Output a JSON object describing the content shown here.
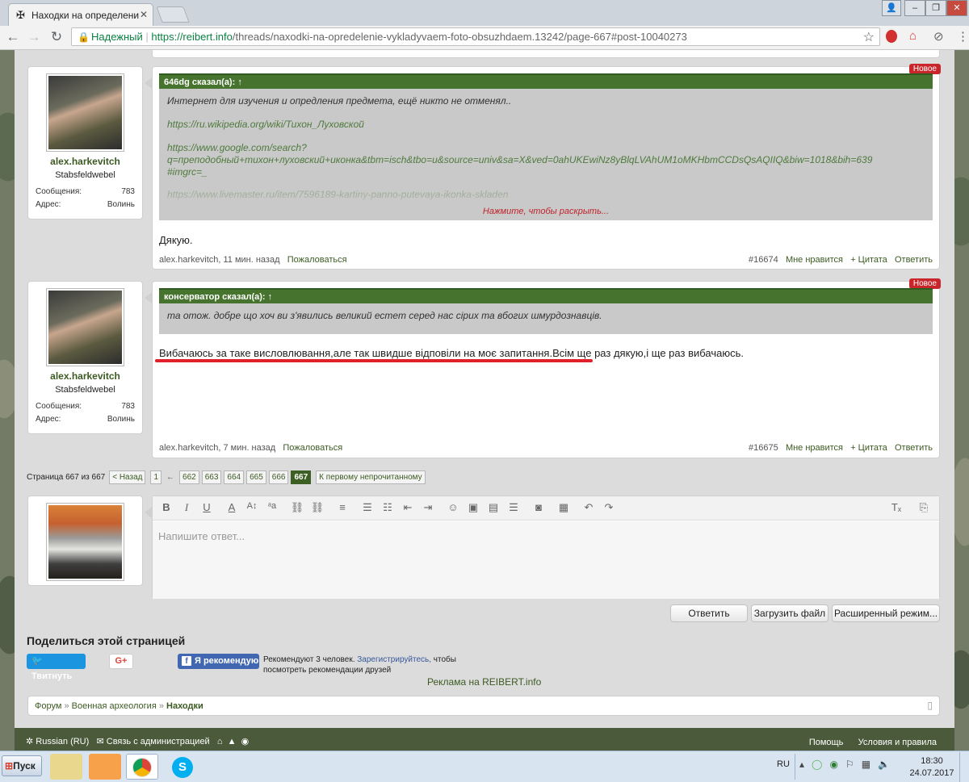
{
  "browser": {
    "tab_title": "Находки на определени",
    "secure_label": "Надежный",
    "url_host": "https://reibert.info",
    "url_path": "/threads/naxodki-na-opredelenie-vykladyvaem-foto-obsuzhdaem.13242/page-667#post-10040273"
  },
  "posts": [
    {
      "author": "alex.harkevitch",
      "rank": "Stabsfeldwebel",
      "stats": [
        {
          "label": "Сообщения:",
          "value": "783"
        },
        {
          "label": "Адрес:",
          "value": "Волинь"
        }
      ],
      "badge": "Новое",
      "quote_head": "646dg сказал(а): ↑",
      "quote_lines": [
        "Интернет для изучения и опредления предмета, ещё никто не отменял..",
        "https://ru.wikipedia.org/wiki/Тихон_Луховской",
        "https://www.google.com/search?",
        "q=преподобный+тихон+луховский+иконка&tbm=isch&tbo=u&source=univ&sa=X&ved=0ahUKEwiNz8yBlqLVAhUM1oMKHbmCCDsQsAQIIQ&biw=1018&bih=639",
        "#imgrc=_",
        "https://www.livemaster.ru/item/7596189-kartiny-panno-putevaya-ikonka-skladen"
      ],
      "expand": "Нажмите, чтобы раскрыть...",
      "body": "Дякую.",
      "meta_author": "alex.harkevitch",
      "meta_time": ", 11 мин. назад",
      "report": "Пожаловаться",
      "num": "#16674",
      "like": "Мне нравится",
      "quote": "+ Цитата",
      "reply": "Ответить"
    },
    {
      "author": "alex.harkevitch",
      "rank": "Stabsfeldwebel",
      "stats": [
        {
          "label": "Сообщения:",
          "value": "783"
        },
        {
          "label": "Адрес:",
          "value": "Волинь"
        }
      ],
      "badge": "Новое",
      "quote_head": "консерватор сказал(а): ↑",
      "quote_lines": [
        "та отож. добре що хоч ви з'явились великий естет серед нас сірих та вбогих шмурдознавців."
      ],
      "body_a": "Вибачаюсь за таке висловлювання,але так швидше відповіли на моє запитання.",
      "body_b": "Всім ще раз дякую,і ще раз вибачаюсь.",
      "meta_author": "alex.harkevitch",
      "meta_time": ", 7 мин. назад",
      "report": "Пожаловаться",
      "num": "#16675",
      "like": "Мне нравится",
      "quote": "+ Цитата",
      "reply": "Ответить"
    }
  ],
  "pagination": {
    "label": "Страница 667 из 667",
    "prev": "< Назад",
    "first": "1",
    "ellipsis": "←",
    "pages": [
      "662",
      "663",
      "664",
      "665",
      "666",
      "667"
    ],
    "unread": "К первому непрочитанному"
  },
  "editor": {
    "placeholder": "Напишите ответ...",
    "reply_btn": "Ответить",
    "upload_btn": "Загрузить файл",
    "advanced_btn": "Расширенный режим..."
  },
  "share": {
    "title": "Поделиться этой страницей",
    "tweet": "Твитнуть",
    "gplus": "G+",
    "fb": "Я рекомендую",
    "fb_text1": "Рекомендуют 3 человек. ",
    "fb_link": "Зарегистрируйтесь,",
    "fb_text2": " чтобы",
    "fb_text3": "посмотреть рекомендации друзей",
    "ad": "Реклама на REIBERT.info"
  },
  "breadcrumb": {
    "items": [
      "Форум",
      "Военная археология",
      "Находки"
    ],
    "sep": "»"
  },
  "footer": {
    "lang": "Russian (RU)",
    "contact": "Связь с администрацией",
    "help": "Помощь",
    "terms": "Условия и правила"
  },
  "taskbar": {
    "start": "Пуск",
    "lang": "RU",
    "time": "18:30",
    "date": "24.07.2017"
  },
  "colors": {
    "quote_header": "#46732e",
    "accent": "#3c5a22",
    "badge": "#c8262b",
    "underline": "#e0202a"
  }
}
